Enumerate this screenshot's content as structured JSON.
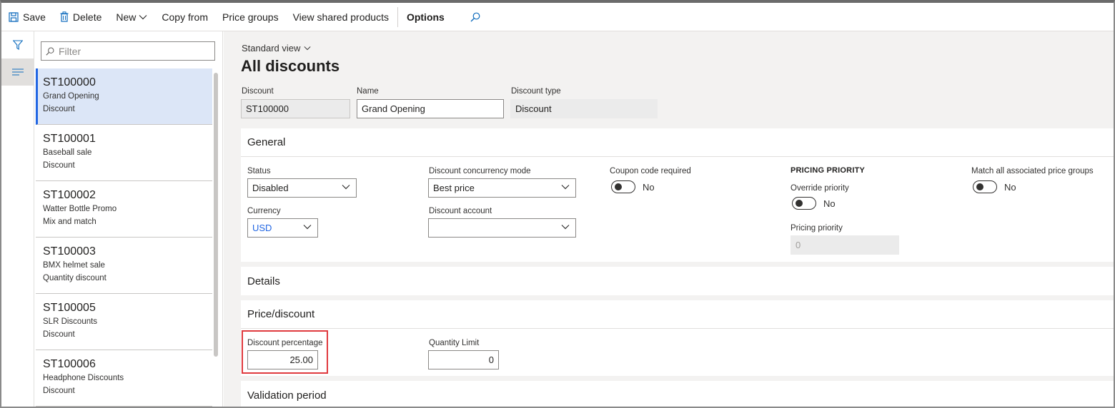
{
  "toolbar": {
    "save": "Save",
    "delete": "Delete",
    "new": "New",
    "copy_from": "Copy from",
    "price_groups": "Price groups",
    "view_shared_products": "View shared products",
    "options": "Options"
  },
  "filter": {
    "placeholder": "Filter"
  },
  "list": [
    {
      "id": "ST100000",
      "name": "Grand Opening",
      "type": "Discount",
      "selected": true
    },
    {
      "id": "ST100001",
      "name": "Baseball sale",
      "type": "Discount"
    },
    {
      "id": "ST100002",
      "name": "Watter Bottle Promo",
      "type": "Mix and match"
    },
    {
      "id": "ST100003",
      "name": "BMX helmet sale",
      "type": "Quantity discount"
    },
    {
      "id": "ST100005",
      "name": "SLR Discounts",
      "type": "Discount"
    },
    {
      "id": "ST100006",
      "name": "Headphone Discounts",
      "type": "Discount"
    }
  ],
  "main": {
    "view": "Standard view",
    "title": "All discounts",
    "discount_label": "Discount",
    "discount_value": "ST100000",
    "name_label": "Name",
    "name_value": "Grand Opening",
    "type_label": "Discount type",
    "type_value": "Discount"
  },
  "general": {
    "heading": "General",
    "status_label": "Status",
    "status_value": "Disabled",
    "currency_label": "Currency",
    "currency_value": "USD",
    "concurrency_label": "Discount concurrency mode",
    "concurrency_value": "Best price",
    "account_label": "Discount account",
    "account_value": "",
    "coupon_label": "Coupon code required",
    "coupon_value": "No",
    "pricing_priority_heading": "PRICING PRIORITY",
    "override_label": "Override priority",
    "override_value": "No",
    "priority_label": "Pricing priority",
    "priority_value": "0",
    "match_label": "Match all associated price groups",
    "match_value": "No"
  },
  "details": {
    "heading": "Details"
  },
  "price": {
    "heading": "Price/discount",
    "pct_label": "Discount percentage",
    "pct_value": "25.00",
    "qty_label": "Quantity Limit",
    "qty_value": "0"
  },
  "validation": {
    "heading": "Validation period"
  },
  "colors": {
    "accent": "#2266e3",
    "highlight": "#e03a3e",
    "selected_row": "#dce6f7"
  }
}
